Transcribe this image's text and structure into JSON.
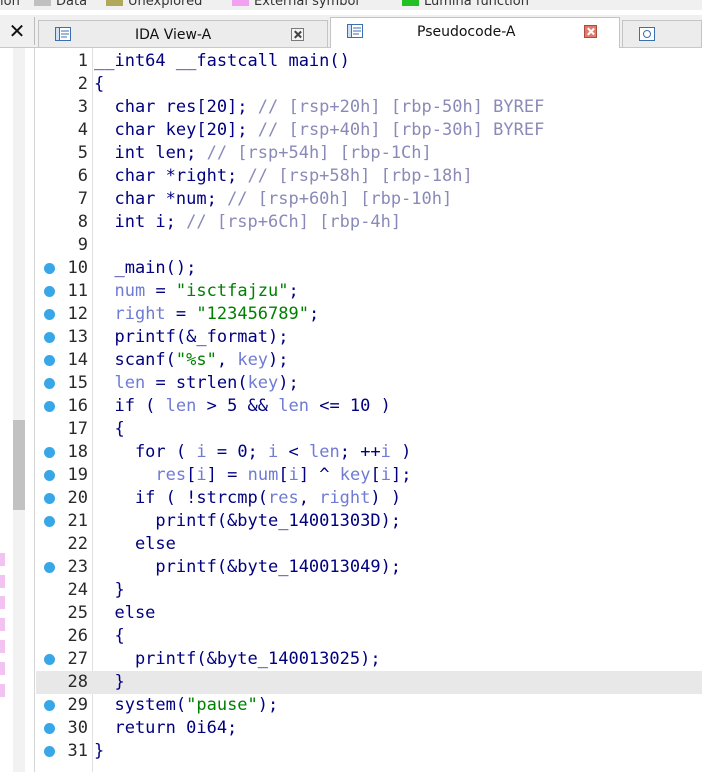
{
  "legend": [
    {
      "label": "ion",
      "color": ""
    },
    {
      "label": "Data",
      "color": "#c0c0c0"
    },
    {
      "label": "Unexplored",
      "color": "#b0a85a"
    },
    {
      "label": "External symbol",
      "color": "#f2a0f0"
    },
    {
      "label": "Lumina function",
      "color": "#22c022"
    }
  ],
  "tabs": [
    {
      "label": "IDA View-A",
      "active": false
    },
    {
      "label": "Pseudocode-A",
      "active": true
    }
  ],
  "colors": {
    "breakpoint_dot": "#38a7e8",
    "keyword": "#000080",
    "string": "#008000",
    "comment": "#8a8ab8",
    "local_var": "#6f7bd4",
    "highlight_line": "#e8e8e8"
  },
  "icons": [
    "close-icon",
    "disassembly-tab-icon",
    "pseudocode-tab-icon",
    "tab-close-icon",
    "hex-view-tab-icon",
    "breakpoint-dot-icon"
  ],
  "code_lines": [
    {
      "n": "1",
      "dot": false,
      "hl": false,
      "tokens": [
        [
          "__int64 __fastcall main()",
          "id"
        ]
      ]
    },
    {
      "n": "2",
      "dot": false,
      "hl": false,
      "tokens": [
        [
          "{",
          "id"
        ]
      ]
    },
    {
      "n": "3",
      "dot": false,
      "hl": false,
      "tokens": [
        [
          "  char res[20]; ",
          "id"
        ],
        [
          "// [rsp+20h] [rbp-50h] BYREF",
          "cmt"
        ]
      ]
    },
    {
      "n": "4",
      "dot": false,
      "hl": false,
      "tokens": [
        [
          "  char key[20]; ",
          "id"
        ],
        [
          "// [rsp+40h] [rbp-30h] BYREF",
          "cmt"
        ]
      ]
    },
    {
      "n": "5",
      "dot": false,
      "hl": false,
      "tokens": [
        [
          "  int len; ",
          "id"
        ],
        [
          "// [rsp+54h] [rbp-1Ch]",
          "cmt"
        ]
      ]
    },
    {
      "n": "6",
      "dot": false,
      "hl": false,
      "tokens": [
        [
          "  char *right; ",
          "id"
        ],
        [
          "// [rsp+58h] [rbp-18h]",
          "cmt"
        ]
      ]
    },
    {
      "n": "7",
      "dot": false,
      "hl": false,
      "tokens": [
        [
          "  char *num; ",
          "id"
        ],
        [
          "// [rsp+60h] [rbp-10h]",
          "cmt"
        ]
      ]
    },
    {
      "n": "8",
      "dot": false,
      "hl": false,
      "tokens": [
        [
          "  int i; ",
          "id"
        ],
        [
          "// [rsp+6Ch] [rbp-4h]",
          "cmt"
        ]
      ]
    },
    {
      "n": "9",
      "dot": false,
      "hl": false,
      "tokens": []
    },
    {
      "n": "10",
      "dot": true,
      "hl": false,
      "tokens": [
        [
          "  _main();",
          "id"
        ]
      ]
    },
    {
      "n": "11",
      "dot": true,
      "hl": false,
      "tokens": [
        [
          "  ",
          "id"
        ],
        [
          "num",
          "lv"
        ],
        [
          " = ",
          "id"
        ],
        [
          "\"isctfajzu\"",
          "s"
        ],
        [
          ";",
          "id"
        ]
      ]
    },
    {
      "n": "12",
      "dot": true,
      "hl": false,
      "tokens": [
        [
          "  ",
          "id"
        ],
        [
          "right",
          "lv"
        ],
        [
          " = ",
          "id"
        ],
        [
          "\"123456789\"",
          "s"
        ],
        [
          ";",
          "id"
        ]
      ]
    },
    {
      "n": "13",
      "dot": true,
      "hl": false,
      "tokens": [
        [
          "  printf(&_format);",
          "id"
        ]
      ]
    },
    {
      "n": "14",
      "dot": true,
      "hl": false,
      "tokens": [
        [
          "  scanf(",
          "id"
        ],
        [
          "\"%s\"",
          "s"
        ],
        [
          ", ",
          "id"
        ],
        [
          "key",
          "lv"
        ],
        [
          ");",
          "id"
        ]
      ]
    },
    {
      "n": "15",
      "dot": true,
      "hl": false,
      "tokens": [
        [
          "  ",
          "id"
        ],
        [
          "len",
          "lv"
        ],
        [
          " = strlen(",
          "id"
        ],
        [
          "key",
          "lv"
        ],
        [
          ");",
          "id"
        ]
      ]
    },
    {
      "n": "16",
      "dot": true,
      "hl": false,
      "tokens": [
        [
          "  if ( ",
          "id"
        ],
        [
          "len",
          "lv"
        ],
        [
          " > 5 && ",
          "id"
        ],
        [
          "len",
          "lv"
        ],
        [
          " <= 10 )",
          "id"
        ]
      ]
    },
    {
      "n": "17",
      "dot": false,
      "hl": false,
      "tokens": [
        [
          "  {",
          "id"
        ]
      ]
    },
    {
      "n": "18",
      "dot": true,
      "hl": false,
      "tokens": [
        [
          "    for ( ",
          "id"
        ],
        [
          "i",
          "lv"
        ],
        [
          " = 0; ",
          "id"
        ],
        [
          "i",
          "lv"
        ],
        [
          " < ",
          "id"
        ],
        [
          "len",
          "lv"
        ],
        [
          "; ++",
          "id"
        ],
        [
          "i",
          "lv"
        ],
        [
          " )",
          "id"
        ]
      ]
    },
    {
      "n": "19",
      "dot": true,
      "hl": false,
      "tokens": [
        [
          "      ",
          "id"
        ],
        [
          "res",
          "lv"
        ],
        [
          "[",
          "id"
        ],
        [
          "i",
          "lv"
        ],
        [
          "] = ",
          "id"
        ],
        [
          "num",
          "lv"
        ],
        [
          "[",
          "id"
        ],
        [
          "i",
          "lv"
        ],
        [
          "] ^ ",
          "id"
        ],
        [
          "key",
          "lv"
        ],
        [
          "[",
          "id"
        ],
        [
          "i",
          "lv"
        ],
        [
          "];",
          "id"
        ]
      ]
    },
    {
      "n": "20",
      "dot": true,
      "hl": false,
      "tokens": [
        [
          "    if ( !strcmp(",
          "id"
        ],
        [
          "res",
          "lv"
        ],
        [
          ", ",
          "id"
        ],
        [
          "right",
          "lv"
        ],
        [
          ") )",
          "id"
        ]
      ]
    },
    {
      "n": "21",
      "dot": true,
      "hl": false,
      "tokens": [
        [
          "      printf(&byte_14001303D);",
          "id"
        ]
      ]
    },
    {
      "n": "22",
      "dot": false,
      "hl": false,
      "tokens": [
        [
          "    else",
          "id"
        ]
      ]
    },
    {
      "n": "23",
      "dot": true,
      "hl": false,
      "tokens": [
        [
          "      printf(&byte_140013049);",
          "id"
        ]
      ]
    },
    {
      "n": "24",
      "dot": false,
      "hl": false,
      "tokens": [
        [
          "  }",
          "id"
        ]
      ]
    },
    {
      "n": "25",
      "dot": false,
      "hl": false,
      "tokens": [
        [
          "  else",
          "id"
        ]
      ]
    },
    {
      "n": "26",
      "dot": false,
      "hl": false,
      "tokens": [
        [
          "  {",
          "id"
        ]
      ]
    },
    {
      "n": "27",
      "dot": true,
      "hl": false,
      "tokens": [
        [
          "    printf(&byte_140013025);",
          "id"
        ]
      ]
    },
    {
      "n": "28",
      "dot": false,
      "hl": true,
      "tokens": [
        [
          "  }",
          "id"
        ]
      ]
    },
    {
      "n": "29",
      "dot": true,
      "hl": false,
      "tokens": [
        [
          "  system(",
          "id"
        ],
        [
          "\"pause\"",
          "s"
        ],
        [
          ");",
          "id"
        ]
      ]
    },
    {
      "n": "30",
      "dot": true,
      "hl": false,
      "tokens": [
        [
          "  return 0i64;",
          "id"
        ]
      ]
    },
    {
      "n": "31",
      "dot": true,
      "hl": false,
      "tokens": [
        [
          "}",
          "id"
        ]
      ]
    }
  ]
}
